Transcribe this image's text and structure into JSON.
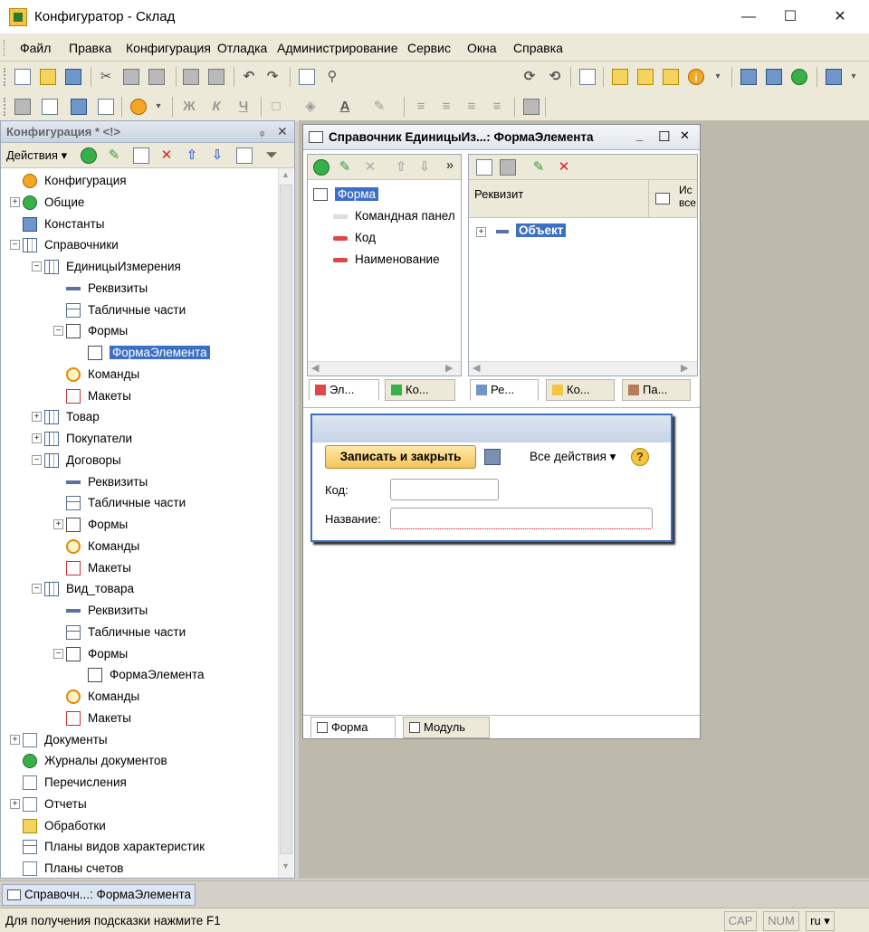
{
  "window": {
    "title": "Конфигуратор - Склад",
    "minimize": "—",
    "maximize": "☐",
    "close": "✕"
  },
  "menu": [
    "Файл",
    "Правка",
    "Конфигурация",
    "Отладка",
    "Администрирование",
    "Сервис",
    "Окна",
    "Справка"
  ],
  "toolbar": {
    "search_value": "",
    "search_clear": "✕",
    "dropdown_arrow": "▾",
    "font_value": "",
    "size_value": ""
  },
  "left_panel": {
    "title": "Конфигурация * <!>",
    "pin": "ᵩ",
    "close": "✕",
    "actions_label": "Действия ▾",
    "tree": [
      {
        "label": "Конфигурация",
        "depth": 0,
        "exp": "",
        "icon": "config"
      },
      {
        "label": "Общие",
        "depth": 0,
        "exp": "+",
        "icon": "common"
      },
      {
        "label": "Константы",
        "depth": 0,
        "exp": "",
        "icon": "constants"
      },
      {
        "label": "Справочники",
        "depth": 0,
        "exp": "−",
        "icon": "catalog"
      },
      {
        "label": "ЕдиницыИзмерения",
        "depth": 1,
        "exp": "−",
        "icon": "catalog"
      },
      {
        "label": "Реквизиты",
        "depth": 2,
        "exp": "",
        "icon": "attribute"
      },
      {
        "label": "Табличные части",
        "depth": 2,
        "exp": "",
        "icon": "table"
      },
      {
        "label": "Формы",
        "depth": 2,
        "exp": "−",
        "icon": "form"
      },
      {
        "label": "ФормаЭлемента",
        "depth": 3,
        "exp": "",
        "icon": "form",
        "selected": true
      },
      {
        "label": "Команды",
        "depth": 2,
        "exp": "",
        "icon": "command"
      },
      {
        "label": "Макеты",
        "depth": 2,
        "exp": "",
        "icon": "layout"
      },
      {
        "label": "Товар",
        "depth": 1,
        "exp": "+",
        "icon": "catalog"
      },
      {
        "label": "Покупатели",
        "depth": 1,
        "exp": "+",
        "icon": "catalog"
      },
      {
        "label": "Договоры",
        "depth": 1,
        "exp": "−",
        "icon": "catalog"
      },
      {
        "label": "Реквизиты",
        "depth": 2,
        "exp": "",
        "icon": "attribute"
      },
      {
        "label": "Табличные части",
        "depth": 2,
        "exp": "",
        "icon": "table"
      },
      {
        "label": "Формы",
        "depth": 2,
        "exp": "+",
        "icon": "form"
      },
      {
        "label": "Команды",
        "depth": 2,
        "exp": "",
        "icon": "command"
      },
      {
        "label": "Макеты",
        "depth": 2,
        "exp": "",
        "icon": "layout"
      },
      {
        "label": "Вид_товара",
        "depth": 1,
        "exp": "−",
        "icon": "catalog"
      },
      {
        "label": "Реквизиты",
        "depth": 2,
        "exp": "",
        "icon": "attribute"
      },
      {
        "label": "Табличные части",
        "depth": 2,
        "exp": "",
        "icon": "table"
      },
      {
        "label": "Формы",
        "depth": 2,
        "exp": "−",
        "icon": "form"
      },
      {
        "label": "ФормаЭлемента",
        "depth": 3,
        "exp": "",
        "icon": "form"
      },
      {
        "label": "Команды",
        "depth": 2,
        "exp": "",
        "icon": "command"
      },
      {
        "label": "Макеты",
        "depth": 2,
        "exp": "",
        "icon": "layout"
      },
      {
        "label": "Документы",
        "depth": 0,
        "exp": "+",
        "icon": "document"
      },
      {
        "label": "Журналы документов",
        "depth": 0,
        "exp": "",
        "icon": "journal"
      },
      {
        "label": "Перечисления",
        "depth": 0,
        "exp": "",
        "icon": "enum"
      },
      {
        "label": "Отчеты",
        "depth": 0,
        "exp": "+",
        "icon": "report"
      },
      {
        "label": "Обработки",
        "depth": 0,
        "exp": "",
        "icon": "processing"
      },
      {
        "label": "Планы видов характеристик",
        "depth": 0,
        "exp": "",
        "icon": "chart-types"
      },
      {
        "label": "Планы счетов",
        "depth": 0,
        "exp": "",
        "icon": "accounts"
      }
    ]
  },
  "form_window": {
    "title": "Справочник ЕдиницыИз...: ФормаЭлемента",
    "min": "_",
    "max": "☐",
    "close": "✕",
    "more": "»",
    "elements": [
      {
        "label": "Форма",
        "depth": 0,
        "selected": true
      },
      {
        "label": "Командная панел",
        "depth": 1
      },
      {
        "label": "Код",
        "depth": 1
      },
      {
        "label": "Наименование",
        "depth": 1
      }
    ],
    "left_tabs": [
      "Эл...",
      "Ко..."
    ],
    "attr_header": "Реквизит",
    "attr_header2": "Ис все",
    "attr_items": [
      {
        "label": "Объект",
        "exp": "+"
      }
    ],
    "right_tabs": [
      "Ре...",
      "Ко...",
      "Па..."
    ],
    "bottom_tabs": [
      "Форма",
      "Модуль"
    ]
  },
  "preview": {
    "save_close": "Записать и закрыть",
    "all_actions": "Все действия ▾",
    "help": "?",
    "code_label": "Код:",
    "name_label": "Название:",
    "code_value": "",
    "name_value": ""
  },
  "taskbar_item": "Справочн...: ФормаЭлемента",
  "status": {
    "hint": "Для получения подсказки нажмите F1",
    "cap": "CAP",
    "num": "NUM",
    "lang": "ru ▾"
  }
}
